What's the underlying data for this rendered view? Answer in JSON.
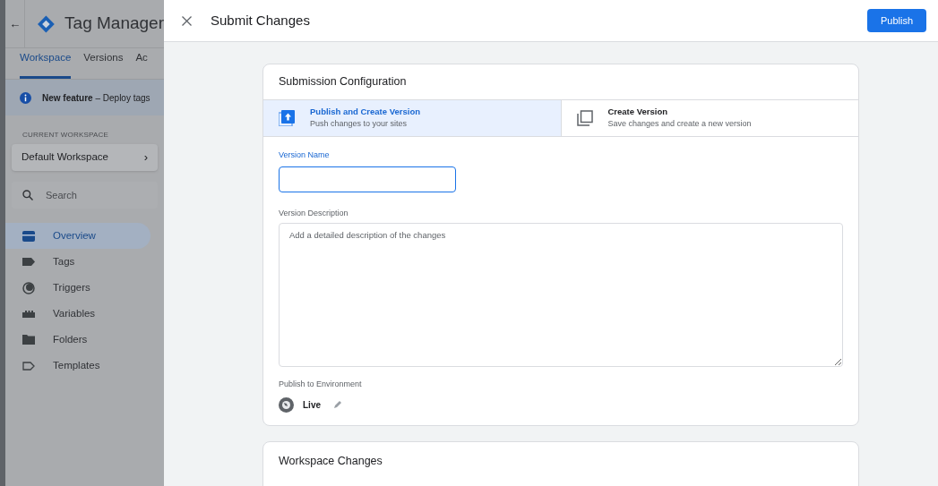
{
  "sidebar": {
    "back": "←",
    "title": "Tag Manager",
    "tabs": [
      {
        "label": "Workspace",
        "selected": true
      },
      {
        "label": "Versions",
        "selected": false
      },
      {
        "label": "Ac",
        "selected": false
      }
    ],
    "notice": {
      "bold": "New feature",
      "text": " – Deploy tags"
    },
    "workspace_label": "CURRENT WORKSPACE",
    "workspace": "Default Workspace",
    "workspace_chevron": "›",
    "search": {
      "placeholder": "Search"
    },
    "nav": [
      {
        "label": "Overview",
        "kind": "overview",
        "selected": true
      },
      {
        "label": "Tags",
        "kind": "tag",
        "selected": false
      },
      {
        "label": "Triggers",
        "kind": "trigger",
        "selected": false
      },
      {
        "label": "Variables",
        "kind": "variable",
        "selected": false
      },
      {
        "label": "Folders",
        "kind": "folder",
        "selected": false
      },
      {
        "label": "Templates",
        "kind": "template",
        "selected": false
      }
    ]
  },
  "dialog": {
    "title": "Submit Changes",
    "publish": "Publish",
    "config": {
      "title": "Submission Configuration",
      "options": [
        {
          "title": "Publish and Create Version",
          "subtitle": "Push changes to your sites",
          "kind": "publish",
          "selected": true
        },
        {
          "title": "Create Version",
          "subtitle": "Save changes and create a new version",
          "kind": "copy",
          "selected": false
        }
      ],
      "version_name": {
        "label": "Version Name"
      },
      "version_description": {
        "label": "Version Description",
        "placeholder": "Add a detailed description of the changes"
      },
      "environment": {
        "label": "Publish to Environment",
        "value": "Live"
      }
    },
    "changes": {
      "title": "Workspace Changes"
    }
  }
}
